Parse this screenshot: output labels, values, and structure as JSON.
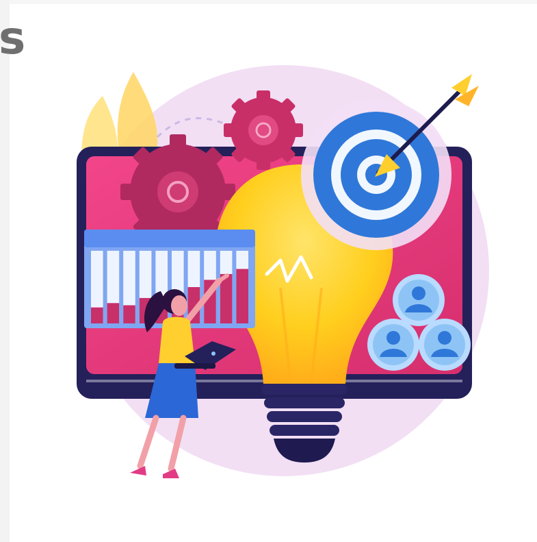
{
  "heading": {
    "visible_fragment": "s"
  },
  "illustration": {
    "subject": "business-strategy-illustration",
    "chart_panel": {
      "bar_levels": [
        0.22,
        0.28,
        0.25,
        0.35,
        0.32,
        0.42,
        0.5,
        0.6,
        0.68,
        0.75
      ]
    },
    "colors": {
      "backdrop_circle": "#f1ddf3",
      "monitor_frame": "#23205a",
      "monitor_screen": "#e6397a",
      "gear": "#b5275e",
      "bulb": "#ffd21e",
      "target_ring_outer": "#2f78d9",
      "target_ring_light": "#e8f3ff",
      "chart_header": "#5b8df0",
      "chart_panel": "#7fa6f2",
      "bar": "#c8306a",
      "dart": "#ffcf2f",
      "person_shirt": "#ffcf2f",
      "person_skirt": "#2b67d6",
      "person_skin": "#f2a0a8",
      "person_hair": "#2a1140",
      "avatar_badge": "#8ec4f5"
    }
  }
}
